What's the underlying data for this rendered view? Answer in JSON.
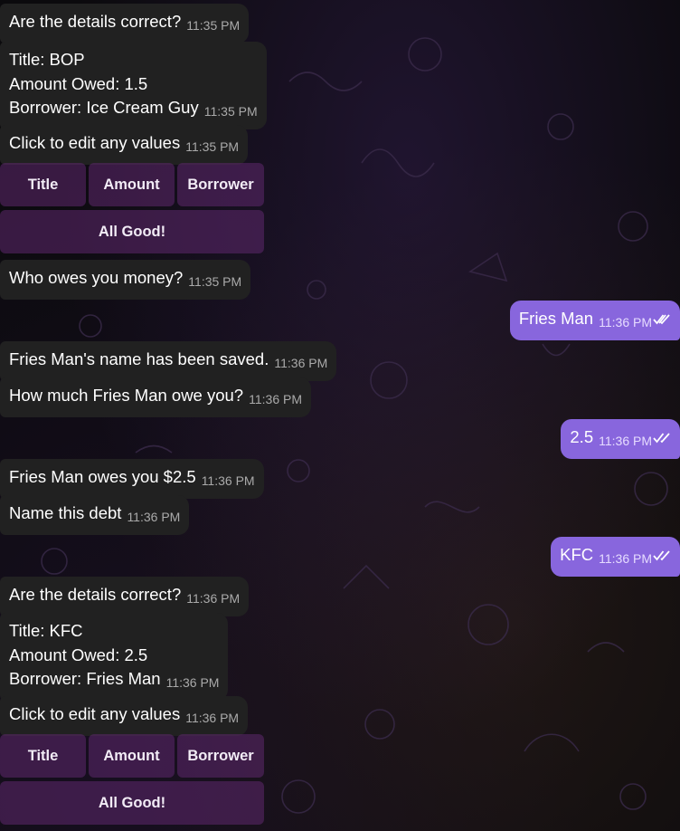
{
  "messages": [
    {
      "text": "Are the details correct?",
      "time": "11:35 PM"
    },
    {
      "lines": [
        "Title: BOP",
        "Amount Owed: 1.5",
        "Borrower: Ice Cream Guy"
      ],
      "time": "11:35 PM"
    },
    {
      "text": "Click to edit any values",
      "time": "11:35 PM"
    },
    {
      "text": "Who owes you money?",
      "time": "11:35 PM"
    },
    {
      "text": "Fries Man",
      "time": "11:36 PM"
    },
    {
      "text": "Fries Man's name has been saved.",
      "time": "11:36 PM"
    },
    {
      "text": "How much Fries Man owe you?",
      "time": "11:36 PM"
    },
    {
      "text": "2.5",
      "time": "11:36 PM"
    },
    {
      "text": "Fries Man owes you $2.5",
      "time": "11:36 PM"
    },
    {
      "text": "Name this debt",
      "time": "11:36 PM"
    },
    {
      "text": "KFC",
      "time": "11:36 PM"
    },
    {
      "text": "Are the details correct?",
      "time": "11:36 PM"
    },
    {
      "lines": [
        "Title: KFC",
        "Amount Owed: 2.5",
        "Borrower: Fries Man"
      ],
      "time": "11:36 PM"
    },
    {
      "text": "Click to edit any values",
      "time": "11:36 PM"
    }
  ],
  "keyboard": {
    "title": "Title",
    "amount": "Amount",
    "borrower": "Borrower",
    "all_good": "All Good!"
  },
  "colors": {
    "incoming_bubble": "#212121",
    "outgoing_bubble": "#8866dd",
    "inline_button": "#4a2157"
  },
  "icons": [
    "double-check-icon"
  ]
}
